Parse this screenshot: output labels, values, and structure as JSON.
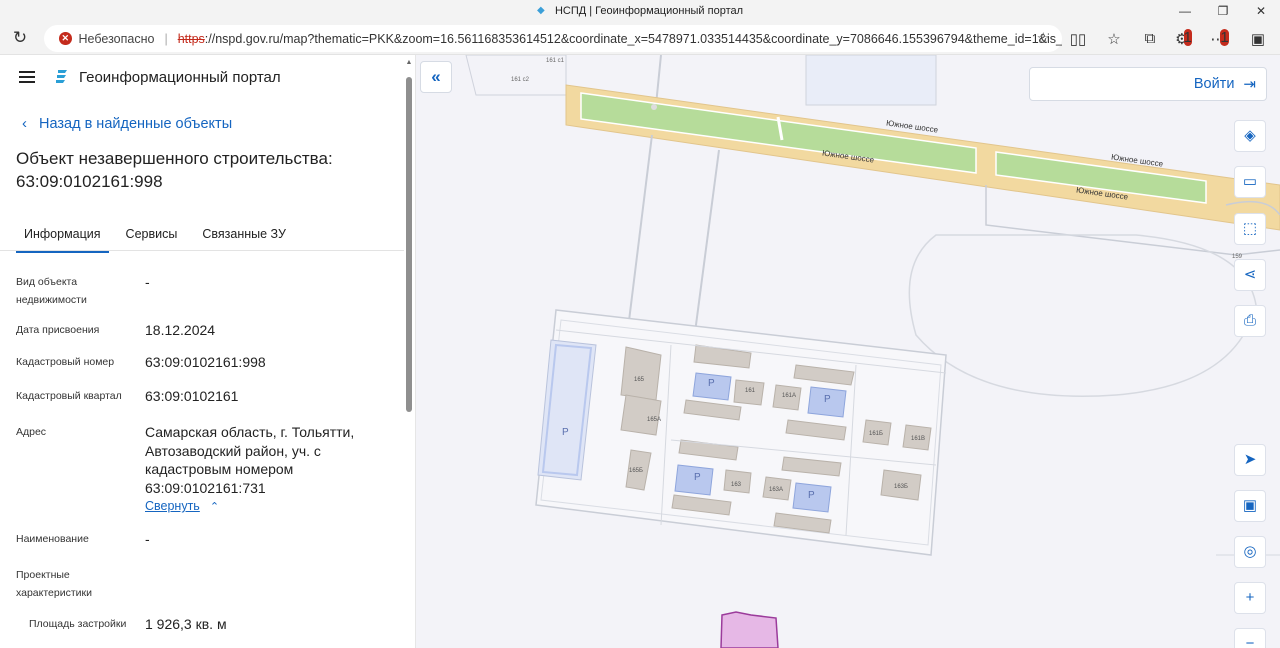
{
  "browser": {
    "tab_title": "НСПД | Геоинформационный портал",
    "security_label": "Небезопасно",
    "url_scheme": "https",
    "url_rest": "://nspd.gov.ru/map?thematic=PKK&zoom=16.561168353614512&coordinate_x=5478971.033514435&coordinate_y=7086646.155396794&theme_id=1&is_cop...",
    "notification_count": "1"
  },
  "panel": {
    "portal_title": "Геоинформационный портал",
    "back_label": "Назад в найденные объекты",
    "object_title": "Объект незавершенного строительства: 63:09:0102161:998",
    "tabs": [
      {
        "label": "Информация",
        "active": true
      },
      {
        "label": "Сервисы",
        "active": false
      },
      {
        "label": "Связанные ЗУ",
        "active": false
      }
    ],
    "properties": [
      {
        "label": "Вид объекта недвижимости",
        "value": "-"
      },
      {
        "label": "Дата присвоения",
        "value": "18.12.2024"
      },
      {
        "label": "Кадастровый номер",
        "value": "63:09:0102161:998"
      },
      {
        "label": "Кадастровый квартал",
        "value": "63:09:0102161"
      },
      {
        "label": "Адрес",
        "value": "Самарская область, г. Тольятти, Автозаводский район, уч. с кадастровым номером 63:09:0102161:731"
      },
      {
        "label": "Наименование",
        "value": "-"
      },
      {
        "label": "Проектные характеристики",
        "value": ""
      },
      {
        "label": "Площадь застройки",
        "value": "1 926,3 кв. м"
      }
    ],
    "collapse_label": "Свернуть"
  },
  "map": {
    "login_label": "Войти",
    "road_name": "Южное шоссе",
    "building_labels": [
      "165",
      "165А",
      "165Б",
      "161",
      "161А",
      "161Б",
      "161В",
      "163",
      "163А",
      "163Б",
      "161 с2",
      "161 с1",
      "159"
    ],
    "parking_label": "P",
    "tools": [
      "layers-icon",
      "ruler-icon",
      "select-area-icon",
      "share-icon",
      "print-icon",
      "locate-icon",
      "minimap-icon",
      "geo-search-icon",
      "zoom-in-icon",
      "zoom-out-icon"
    ],
    "colors": {
      "road": "#f2d9a0",
      "median": "#b6dc9a",
      "building": "#d2ccc6",
      "parking": "#b9c8ee",
      "selected": "#e6b8e6",
      "accent": "#1565c0"
    }
  }
}
